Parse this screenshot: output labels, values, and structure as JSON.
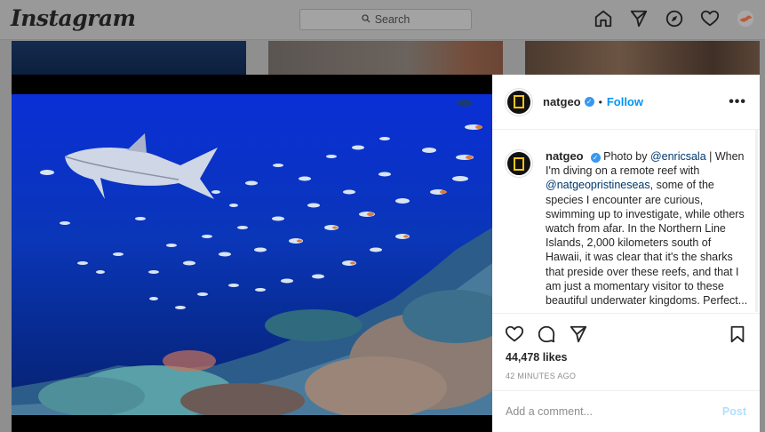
{
  "topbar": {
    "logo": "Instagram",
    "search_placeholder": "Search",
    "nav_icons": [
      "home-icon",
      "direct-icon",
      "explore-icon",
      "activity-heart-icon",
      "profile-avatar"
    ]
  },
  "post": {
    "username": "natgeo",
    "verified": true,
    "follow_label": "Follow",
    "separator": "•",
    "more_label": "•••",
    "caption": {
      "prefix": "Photo by ",
      "mention1": "@enricsala",
      "after_mention1": " | When I'm diving on a remote reef with ",
      "mention2": "@natgeopristineseas",
      "body": ", some of the species I encounter are curious, swimming up to investigate, while others watch from afar. In the Northern Line Islands, 2,000 kilometers south of Hawaii, it was clear that it's the sharks that preside over these reefs, and that I am just a momentary visitor to these beautiful underwater kingdoms. Perfect..."
    },
    "likes": "44,478 likes",
    "time": "42 MINUTES AGO",
    "comment_placeholder": "Add a comment...",
    "post_label": "Post"
  },
  "colors": {
    "accent": "#0095f6",
    "verified": "#3897f0",
    "natgeo_yellow": "#f5c518",
    "post_disabled": "#b2dffc"
  }
}
